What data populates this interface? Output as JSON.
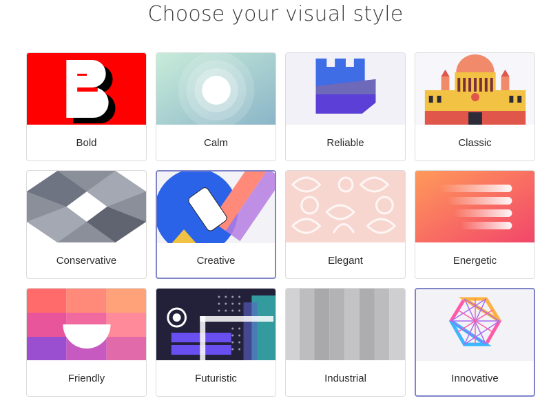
{
  "title": "Choose your visual style",
  "styles": [
    {
      "label": "Bold",
      "selected": false
    },
    {
      "label": "Calm",
      "selected": false
    },
    {
      "label": "Reliable",
      "selected": false
    },
    {
      "label": "Classic",
      "selected": false
    },
    {
      "label": "Conservative",
      "selected": false
    },
    {
      "label": "Creative",
      "selected": true
    },
    {
      "label": "Elegant",
      "selected": false
    },
    {
      "label": "Energetic",
      "selected": false
    },
    {
      "label": "Friendly",
      "selected": false
    },
    {
      "label": "Futuristic",
      "selected": false
    },
    {
      "label": "Industrial",
      "selected": false
    },
    {
      "label": "Innovative",
      "selected": true
    }
  ],
  "colors": {
    "selected_border": "#7f84c9",
    "card_border": "#dcdcdc",
    "bold_red": "#ff0000",
    "reliable_blue": "#3f6de6",
    "reliable_purple": "#5b3fd6"
  }
}
